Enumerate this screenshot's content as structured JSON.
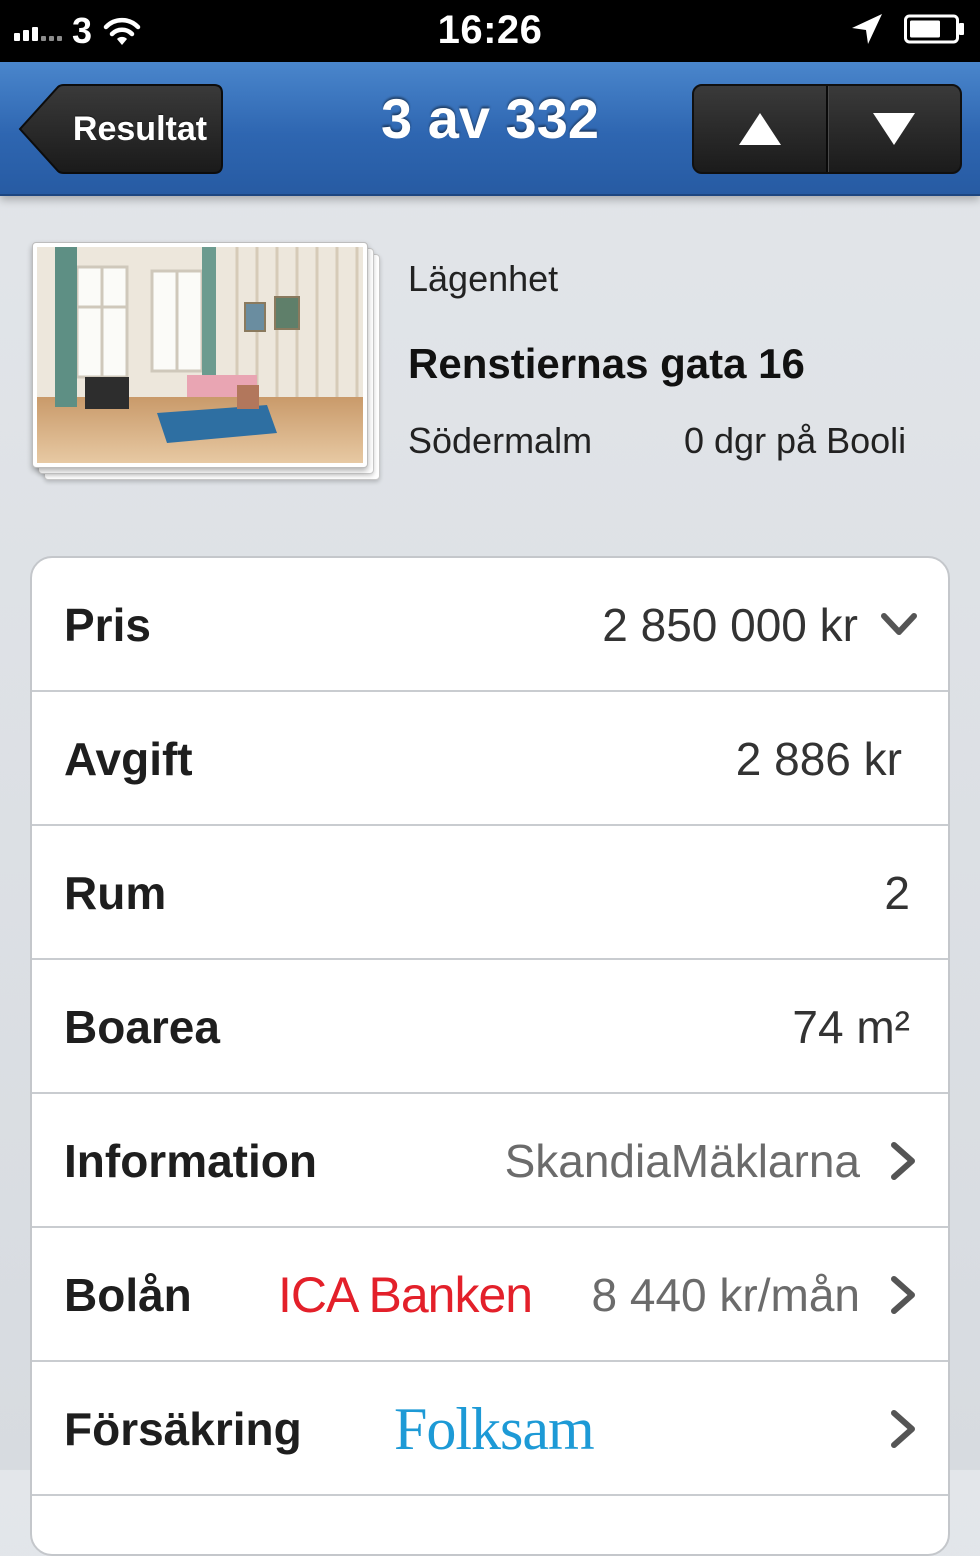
{
  "status_bar": {
    "carrier": "3",
    "time": "16:26",
    "icons": [
      "signal-icon",
      "wifi-icon",
      "location-icon",
      "battery-icon"
    ]
  },
  "nav": {
    "back_label": "Resultat",
    "title": "3 av 332",
    "up_icon": "arrow-up-icon",
    "down_icon": "arrow-down-icon",
    "bar_color": "#2e66b1"
  },
  "listing": {
    "type": "Lägenhet",
    "address": "Renstiernas gata 16",
    "area": "Södermalm",
    "days_on_site": "0 dgr på Booli"
  },
  "details": {
    "price_label": "Pris",
    "price_value": "2 850 000 kr",
    "fee_label": "Avgift",
    "fee_value": "2 886 kr",
    "rooms_label": "Rum",
    "rooms_value": "2",
    "size_label": "Boarea",
    "size_value": "74 m²",
    "info_label": "Information",
    "info_value": "SkandiaMäklarna",
    "mortgage_label": "Bolån",
    "mortgage_provider": "ICA Banken",
    "mortgage_value": "8 440 kr/mån",
    "insurance_label": "Försäkring",
    "insurance_provider": "Folksam"
  },
  "colors": {
    "ica_red": "#e3202a",
    "folksam_blue": "#1d9ad6"
  }
}
